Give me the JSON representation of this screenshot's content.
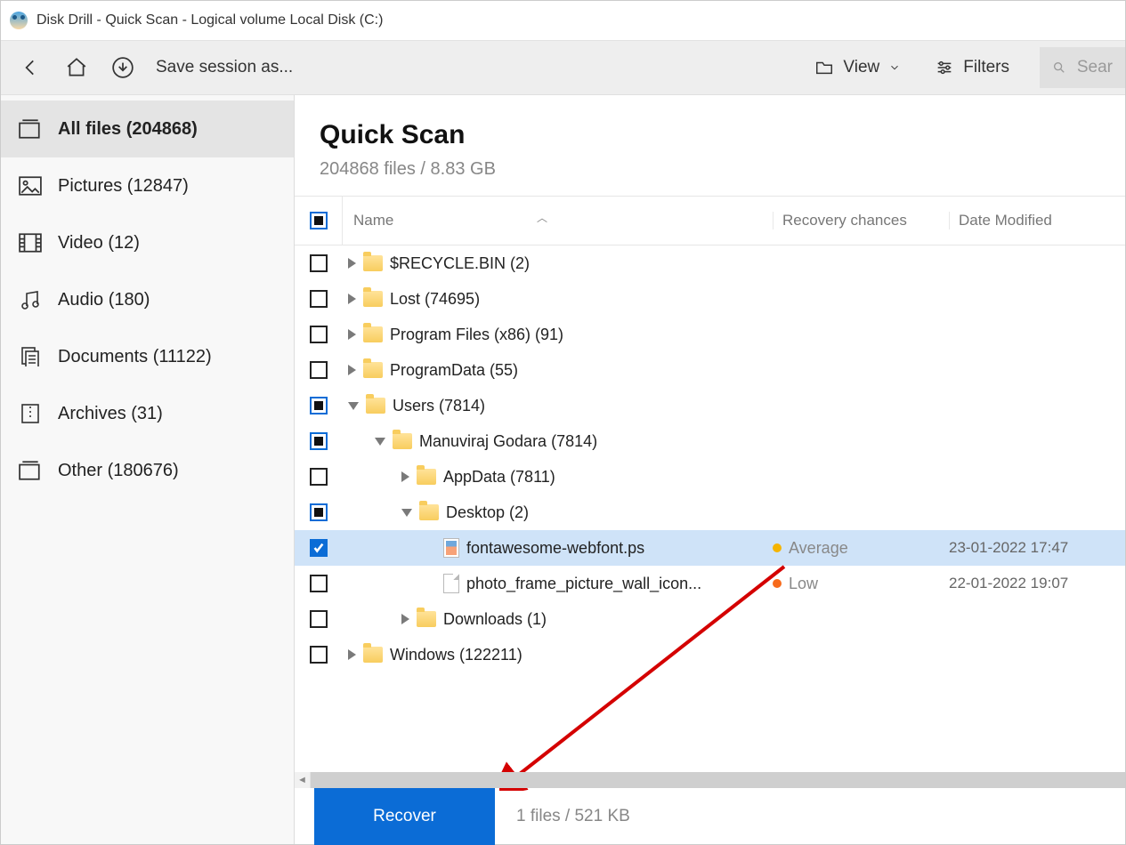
{
  "title": "Disk Drill - Quick Scan - Logical volume Local Disk (C:)",
  "toolbar": {
    "save_session": "Save session as...",
    "view": "View",
    "filters": "Filters",
    "search_placeholder": "Sear"
  },
  "sidebar": {
    "items": [
      {
        "label": "All files (204868)",
        "active": true
      },
      {
        "label": "Pictures (12847)"
      },
      {
        "label": "Video (12)"
      },
      {
        "label": "Audio (180)"
      },
      {
        "label": "Documents (11122)"
      },
      {
        "label": "Archives (31)"
      },
      {
        "label": "Other (180676)"
      }
    ]
  },
  "main": {
    "title": "Quick Scan",
    "subtitle": "204868 files / 8.83 GB",
    "columns": {
      "name": "Name",
      "recovery": "Recovery chances",
      "date": "Date Modified"
    },
    "rows": [
      {
        "indent": 0,
        "check": "off",
        "expand": "right",
        "type": "folder",
        "name": "$RECYCLE.BIN (2)"
      },
      {
        "indent": 0,
        "check": "off",
        "expand": "right",
        "type": "folder",
        "name": "Lost (74695)"
      },
      {
        "indent": 0,
        "check": "off",
        "expand": "right",
        "type": "folder",
        "name": "Program Files (x86) (91)"
      },
      {
        "indent": 0,
        "check": "off",
        "expand": "right",
        "type": "folder",
        "name": "ProgramData (55)"
      },
      {
        "indent": 0,
        "check": "mixed",
        "expand": "down",
        "type": "folder",
        "name": "Users (7814)"
      },
      {
        "indent": 1,
        "check": "mixed",
        "expand": "down",
        "type": "folder",
        "name": "Manuviraj Godara (7814)"
      },
      {
        "indent": 2,
        "check": "off",
        "expand": "right",
        "type": "folder",
        "name": "AppData (7811)"
      },
      {
        "indent": 2,
        "check": "mixed",
        "expand": "down",
        "type": "folder",
        "name": "Desktop (2)"
      },
      {
        "indent": 3,
        "check": "on",
        "type": "ps",
        "name": "fontawesome-webfont.ps",
        "selected": true,
        "recovery": "Average",
        "recdot": "avg",
        "date": "23-01-2022 17:47"
      },
      {
        "indent": 3,
        "check": "off",
        "type": "file",
        "name": "photo_frame_picture_wall_icon...",
        "recovery": "Low",
        "recdot": "low",
        "date": "22-01-2022 19:07"
      },
      {
        "indent": 2,
        "check": "off",
        "expand": "right",
        "type": "folder",
        "name": "Downloads (1)"
      },
      {
        "indent": 0,
        "check": "off",
        "expand": "right",
        "type": "folder",
        "name": "Windows (122211)"
      }
    ]
  },
  "footer": {
    "recover": "Recover",
    "status": "1 files / 521 KB"
  }
}
